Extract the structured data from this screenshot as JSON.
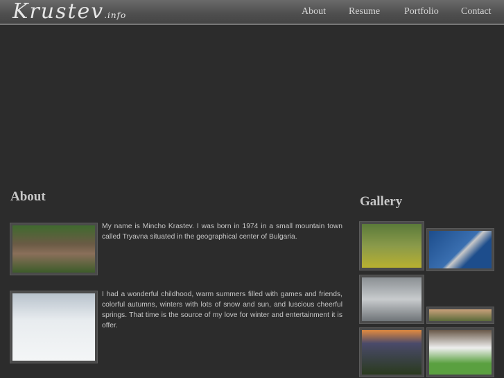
{
  "header": {
    "logo": "Krustev",
    "logo_suffix": ".info",
    "nav": [
      "About",
      "Resume",
      "Portfolio",
      "Contact"
    ]
  },
  "about": {
    "title": "About",
    "paragraphs": [
      "My name is Mincho Krastev. I was born in 1974 in a small mountain town called Tryavna situated in the geographical center of Bulgaria.",
      "I had a wonderful childhood, warm summers filled with games and friends, colorful autumns, winters with lots of snow and sun, and luscious cheerful springs. That time is the source of my love for winter and entertainment it is offer."
    ]
  },
  "gallery": {
    "title": "Gallery"
  }
}
